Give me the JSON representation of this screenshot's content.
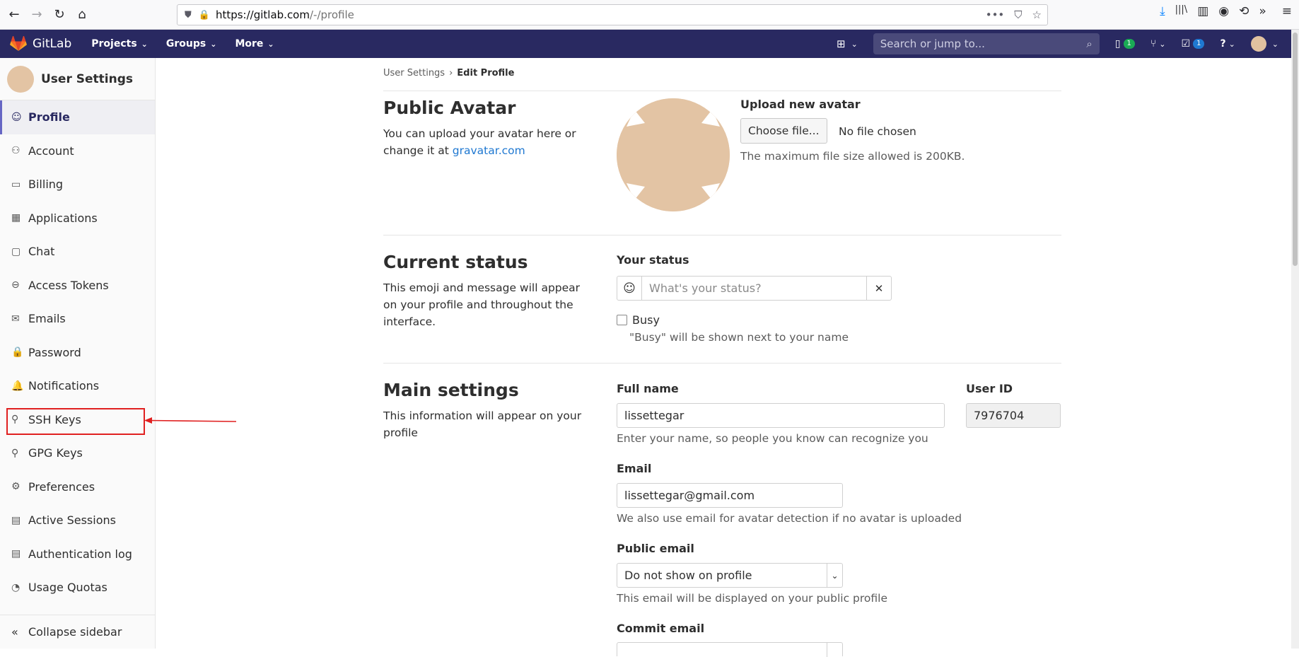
{
  "browser": {
    "url_host": "https://gitlab.com",
    "url_path": "/-/profile",
    "back_glyph": "←",
    "forward_glyph": "→",
    "reload_glyph": "↻",
    "home_glyph": "⌂",
    "more_glyph": "•••",
    "pocket_glyph": "⛉",
    "star_glyph": "☆",
    "download_glyph": "⤓",
    "library_glyph": "|||\\",
    "sidebar_glyph": "▥",
    "account_glyph": "◉",
    "history_glyph": "⟲",
    "overflow_glyph": "»",
    "menu_glyph": "≡"
  },
  "nav": {
    "brand": "GitLab",
    "menus": [
      {
        "label": "Projects"
      },
      {
        "label": "Groups"
      },
      {
        "label": "More"
      }
    ],
    "caret": "⌄",
    "plus_glyph": "⊞",
    "search_placeholder": "Search or jump to...",
    "search_icon": "⌕",
    "issues_glyph": "▯",
    "issues_count": "1",
    "mr_glyph": "⑂",
    "todos_glyph": "☑",
    "todos_count": "1",
    "help_glyph": "?"
  },
  "sidebar": {
    "title": "User Settings",
    "items": [
      {
        "label": "Profile",
        "icon": "☺"
      },
      {
        "label": "Account",
        "icon": "⚇"
      },
      {
        "label": "Billing",
        "icon": "▭"
      },
      {
        "label": "Applications",
        "icon": "▦"
      },
      {
        "label": "Chat",
        "icon": "▢"
      },
      {
        "label": "Access Tokens",
        "icon": "⊖"
      },
      {
        "label": "Emails",
        "icon": "✉"
      },
      {
        "label": "Password",
        "icon": "🔒"
      },
      {
        "label": "Notifications",
        "icon": "🔔"
      },
      {
        "label": "SSH Keys",
        "icon": "⚲"
      },
      {
        "label": "GPG Keys",
        "icon": "⚲"
      },
      {
        "label": "Preferences",
        "icon": "⚙"
      },
      {
        "label": "Active Sessions",
        "icon": "▤"
      },
      {
        "label": "Authentication log",
        "icon": "▤"
      },
      {
        "label": "Usage Quotas",
        "icon": "◔"
      }
    ],
    "collapse_label": "Collapse sidebar",
    "collapse_icon": "«"
  },
  "breadcrumb": {
    "parent": "User Settings",
    "separator": "›",
    "current": "Edit Profile"
  },
  "avatar_section": {
    "title": "Public Avatar",
    "desc_prefix": "You can upload your avatar here or change it at ",
    "desc_link": "gravatar.com",
    "upload_label": "Upload new avatar",
    "choose_button": "Choose file...",
    "no_file": "No file chosen",
    "max_size_help": "The maximum file size allowed is 200KB."
  },
  "status_section": {
    "title": "Current status",
    "desc": "This emoji and message will appear on your profile and throughout the interface.",
    "your_status_label": "Your status",
    "emoji_glyph": "☺",
    "status_placeholder": "What's your status?",
    "clear_glyph": "✕",
    "busy_label": "Busy",
    "busy_help": "\"Busy\" will be shown next to your name"
  },
  "main_section": {
    "title": "Main settings",
    "desc": "This information will appear on your profile",
    "full_name_label": "Full name",
    "full_name_value": "lissettegar",
    "full_name_help": "Enter your name, so people you know can recognize you",
    "user_id_label": "User ID",
    "user_id_value": "7976704",
    "email_label": "Email",
    "email_value": "lissettegar@gmail.com",
    "email_help": "We also use email for avatar detection if no avatar is uploaded",
    "public_email_label": "Public email",
    "public_email_value": "Do not show on profile",
    "public_email_help": "This email will be displayed on your public profile",
    "commit_email_label": "Commit email",
    "dropdown_glyph": "⌄"
  },
  "colors": {
    "navbar": "#292961",
    "link": "#1f78d1",
    "highlight": "#e02020",
    "avatar": "#e3c4a4"
  }
}
